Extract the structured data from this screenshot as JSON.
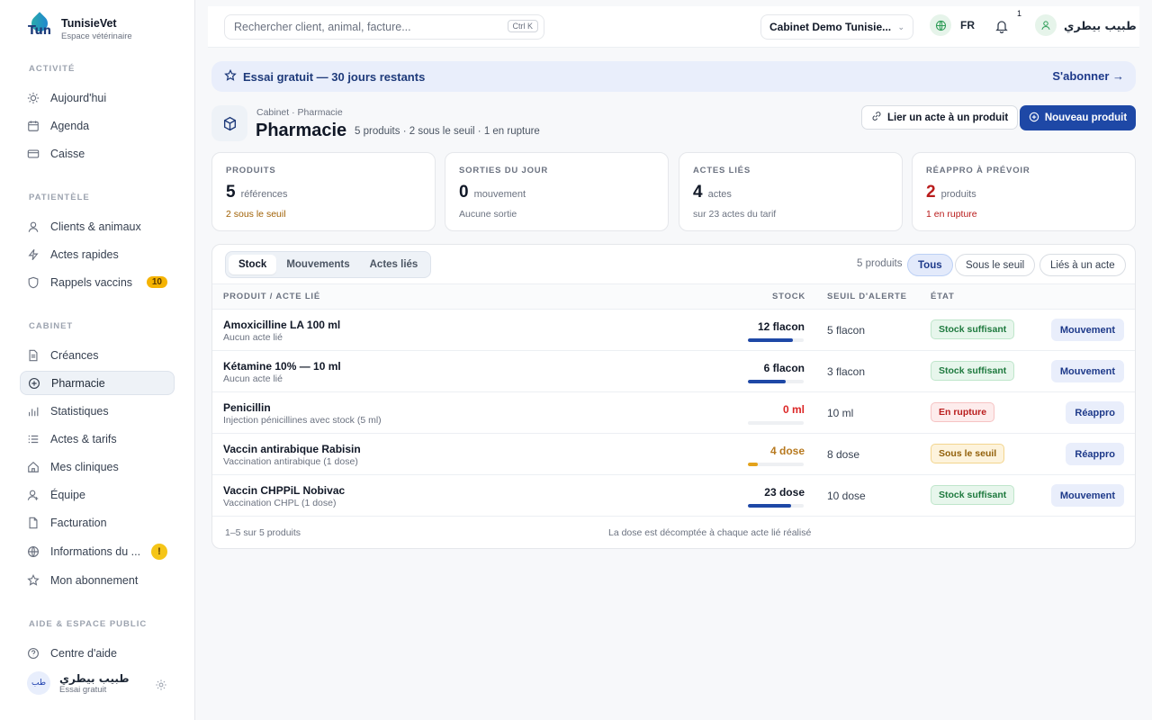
{
  "brand": {
    "name": "TunisieVet",
    "subtitle": "Espace vétérinaire",
    "logo_text": "Tun"
  },
  "sidebar": {
    "sections": [
      {
        "title": "ACTIVITÉ",
        "items": [
          {
            "label": "Aujourd'hui",
            "icon": "sun-icon"
          },
          {
            "label": "Agenda",
            "icon": "calendar-icon"
          },
          {
            "label": "Caisse",
            "icon": "wallet-icon"
          }
        ]
      },
      {
        "title": "PATIENTÈLE",
        "items": [
          {
            "label": "Clients & animaux",
            "icon": "user-icon"
          },
          {
            "label": "Actes rapides",
            "icon": "bolt-icon"
          },
          {
            "label": "Rappels vaccins",
            "icon": "shield-icon",
            "badge": "10"
          }
        ]
      },
      {
        "title": "CABINET",
        "items": [
          {
            "label": "Créances",
            "icon": "document-icon"
          },
          {
            "label": "Pharmacie",
            "icon": "plus-circle-icon",
            "active": true
          },
          {
            "label": "Statistiques",
            "icon": "bar-chart-icon"
          },
          {
            "label": "Actes & tarifs",
            "icon": "list-icon"
          },
          {
            "label": "Mes cliniques",
            "icon": "home-icon"
          },
          {
            "label": "Équipe",
            "icon": "team-icon"
          },
          {
            "label": "Facturation",
            "icon": "file-icon"
          },
          {
            "label": "Informations du ...",
            "icon": "globe-icon",
            "warn": "!"
          },
          {
            "label": "Mon abonnement",
            "icon": "star-icon"
          }
        ]
      },
      {
        "title": "AIDE & ESPACE PUBLIC",
        "items": [
          {
            "label": "Centre d'aide",
            "icon": "help-icon"
          }
        ]
      }
    ],
    "user": {
      "initials": "طب",
      "name": "طبيب بيطري",
      "plan": "Essai gratuit"
    }
  },
  "topbar": {
    "search_placeholder": "Rechercher client, animal, facture...",
    "shortcut": "Ctrl K",
    "cabinet": "Cabinet Demo Tunisie...",
    "lang": "FR",
    "notif_count": "1",
    "user_name": "طبيب بيطري"
  },
  "trial": {
    "text": "Essai gratuit — 30 jours restants",
    "cta": "S'abonner →"
  },
  "page": {
    "breadcrumb": "Cabinet · Pharmacie",
    "title": "Pharmacie",
    "meta": "5 produits · 2 sous le seuil · 1 en rupture",
    "btn_link": "Lier un acte à un produit",
    "btn_new": "Nouveau produit"
  },
  "kpis": [
    {
      "label": "PRODUITS",
      "value": "5",
      "unit": "références",
      "note": "2 sous le seuil",
      "note_tone": "warn"
    },
    {
      "label": "SORTIES DU JOUR",
      "value": "0",
      "unit": "mouvement",
      "note": "Aucune sortie",
      "note_tone": "muted"
    },
    {
      "label": "ACTES LIÉS",
      "value": "4",
      "unit": "actes",
      "note": "sur 23 actes du tarif",
      "note_tone": "muted"
    },
    {
      "label": "RÉAPPRO À PRÉVOIR",
      "value": "2",
      "unit": "produits",
      "note": "1 en rupture",
      "note_tone": "danger"
    }
  ],
  "table": {
    "tabs": [
      "Stock",
      "Mouvements",
      "Actes liés"
    ],
    "count": "5 produits",
    "filters": [
      "Tous",
      "Sous le seuil",
      "Liés à un acte"
    ],
    "headers": {
      "product": "PRODUIT / ACTE LIÉ",
      "stock": "STOCK",
      "seuil": "SEUIL D'ALERTE",
      "etat": "ÉTAT"
    },
    "rows": [
      {
        "name": "Amoxicilline LA 100 ml",
        "act": "Aucun acte lié",
        "stock": "12 flacon",
        "level": 0.8,
        "tone": "ok",
        "seuil": "5 flacon",
        "status": "Stock suffisant",
        "action": "Mouvement"
      },
      {
        "name": "Kétamine 10% — 10 ml",
        "act": "Aucun acte lié",
        "stock": "6 flacon",
        "level": 0.67,
        "tone": "ok",
        "seuil": "3 flacon",
        "status": "Stock suffisant",
        "action": "Mouvement"
      },
      {
        "name": "Penicillin",
        "act": "Injection pénicillines avec stock (5 ml)",
        "stock": "0 ml",
        "level": 0,
        "tone": "out",
        "seuil": "10 ml",
        "status": "En rupture",
        "action": "Réappro"
      },
      {
        "name": "Vaccin antirabique Rabisin",
        "act": "Vaccination antirabique (1 dose)",
        "stock": "4 dose",
        "level": 0.17,
        "tone": "low",
        "seuil": "8 dose",
        "status": "Sous le seuil",
        "action": "Réappro"
      },
      {
        "name": "Vaccin CHPPiL Nobivac",
        "act": "Vaccination CHPL (1 dose)",
        "stock": "23 dose",
        "level": 0.77,
        "tone": "ok",
        "seuil": "10 dose",
        "status": "Stock suffisant",
        "action": "Mouvement"
      }
    ],
    "footer_left": "1–5 sur 5 produits",
    "footer_note": "La dose est décomptée à chaque acte lié réalisé"
  }
}
